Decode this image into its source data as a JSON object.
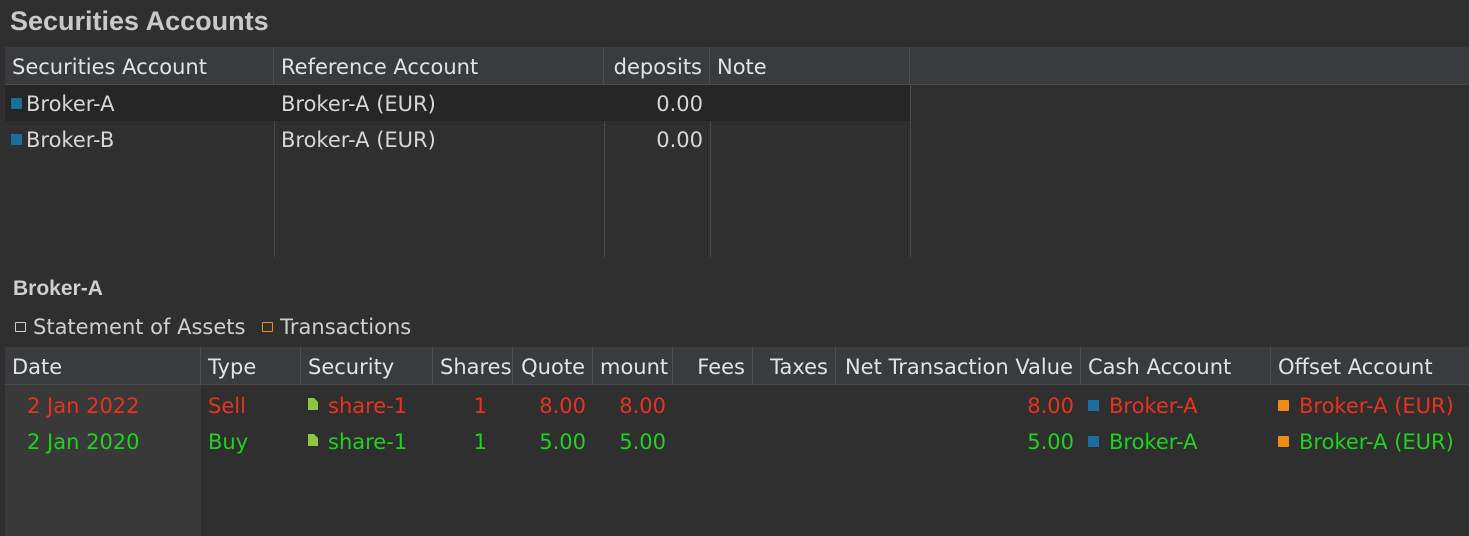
{
  "page": {
    "title": "Securities Accounts"
  },
  "accounts_table": {
    "headers": [
      "Securities Account",
      "Reference Account",
      "deposits",
      "Note"
    ],
    "rows": [
      {
        "account": "Broker-A",
        "reference": "Broker-A (EUR)",
        "deposits": "0.00",
        "note": ""
      },
      {
        "account": "Broker-B",
        "reference": "Broker-A (EUR)",
        "deposits": "0.00",
        "note": ""
      }
    ]
  },
  "detail": {
    "title": "Broker-A",
    "tabs": [
      {
        "label": "Statement of Assets",
        "icon": "statement-icon"
      },
      {
        "label": "Transactions",
        "icon": "transactions-icon"
      }
    ]
  },
  "transactions_table": {
    "headers": [
      "Date",
      "Type",
      "Security",
      "Shares",
      "Quote",
      "mount",
      "Fees",
      "Taxes",
      "Net Transaction Value",
      "Cash Account",
      "Offset Account"
    ],
    "rows": [
      {
        "date": "2 Jan 2022",
        "type": "Sell",
        "security": "share-1",
        "shares": "1",
        "quote": "8.00",
        "amount": "8.00",
        "fees": "",
        "taxes": "",
        "net": "8.00",
        "cash_account": "Broker-A",
        "offset_account": "Broker-A (EUR)",
        "color": "#e8321e"
      },
      {
        "date": "2 Jan 2020",
        "type": "Buy",
        "security": "share-1",
        "shares": "1",
        "quote": "5.00",
        "amount": "5.00",
        "fees": "",
        "taxes": "",
        "net": "5.00",
        "cash_account": "Broker-A",
        "offset_account": "Broker-A (EUR)",
        "color": "#1ed21e"
      }
    ]
  },
  "colors": {
    "sell": "#e8321e",
    "buy": "#1ed21e",
    "account_icon": "#1c6e9c",
    "offset_icon": "#f08c10",
    "security_icon": "#8dc63f"
  }
}
